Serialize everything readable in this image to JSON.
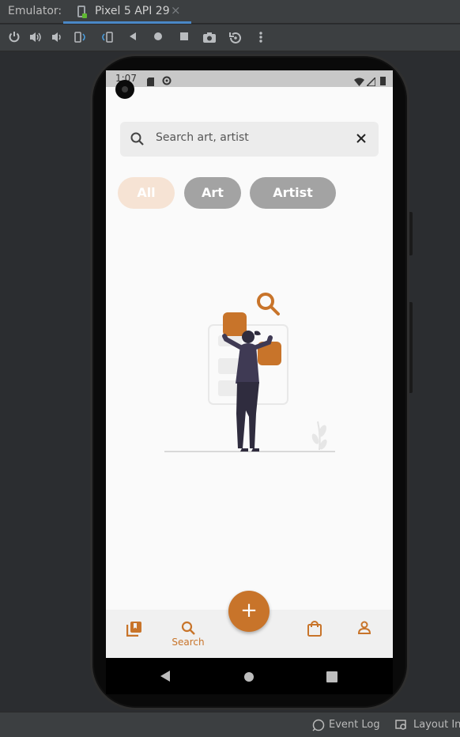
{
  "ide": {
    "emulator_label": "Emulator:",
    "device_tab": "Pixel 5 API 29",
    "tab_close": "×",
    "event_log": "Event Log",
    "layout_inspector": "Layout Ins"
  },
  "device": {
    "status_time": "1:07"
  },
  "app": {
    "search_placeholder": "Search art, artist",
    "chips": [
      {
        "label": "All",
        "selected": true
      },
      {
        "label": "Art",
        "selected": false
      },
      {
        "label": "Artist",
        "selected": false
      }
    ],
    "fab_label": "+",
    "nav": [
      {
        "icon": "library-icon",
        "label": ""
      },
      {
        "icon": "search-icon",
        "label": "Search"
      },
      {
        "icon": "shopping-bag-icon",
        "label": ""
      },
      {
        "icon": "person-icon",
        "label": ""
      }
    ],
    "accent_color": "#c8742a",
    "chip_selected_bg": "#f6e3d4",
    "chip_unselected_bg": "#a3a3a3"
  }
}
